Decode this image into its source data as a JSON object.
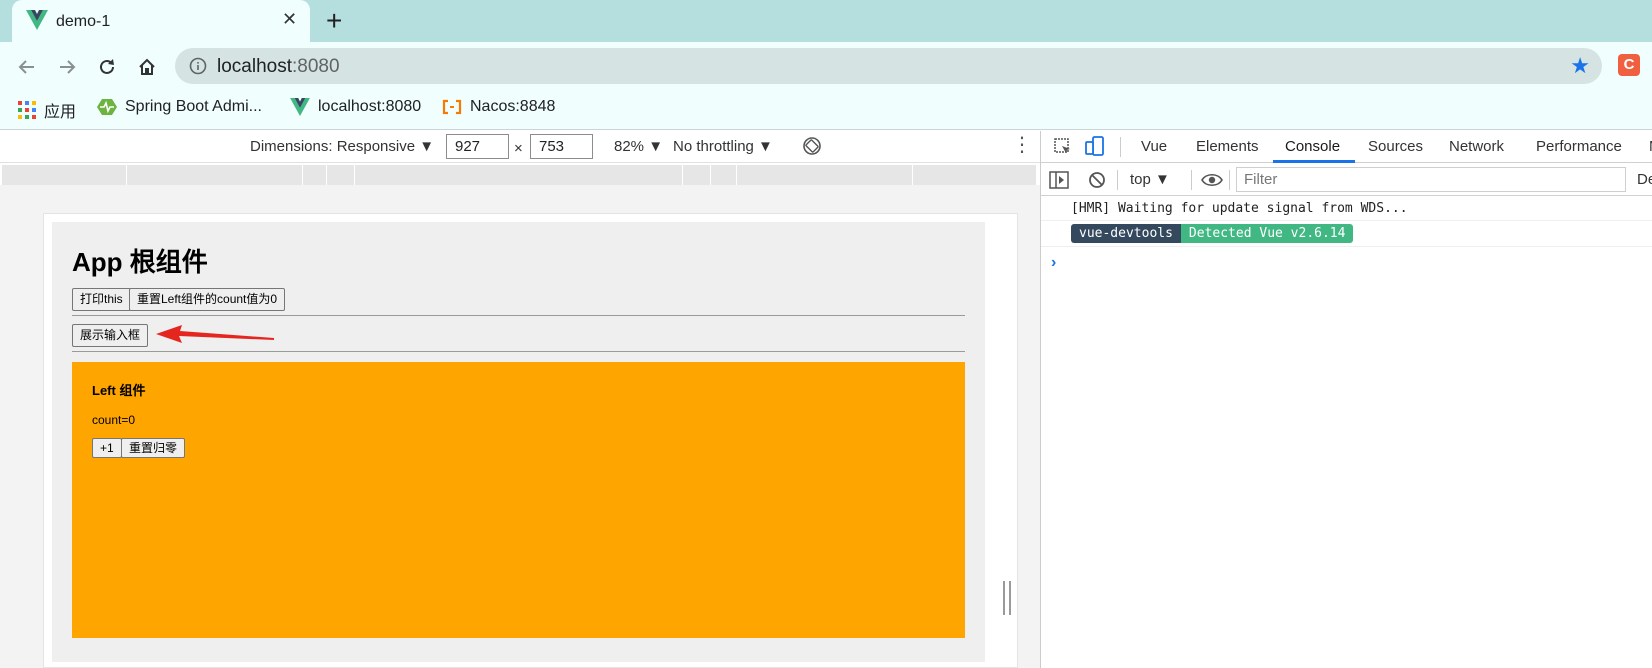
{
  "browser": {
    "tab": {
      "title": "demo-1",
      "close": "✕",
      "favicon": "vue-logo-icon"
    },
    "new_tab": "+",
    "url": {
      "host": "localhost",
      "port": ":8080"
    },
    "extension_letter": "C",
    "bookmarks": [
      {
        "label": "应用",
        "icon": "apps-grid-icon"
      },
      {
        "label": "Spring Boot Admi...",
        "icon": "spring-boot-admin-icon"
      },
      {
        "label": "localhost:8080",
        "icon": "vue-logo-icon"
      },
      {
        "label": "Nacos:8848",
        "icon": "nacos-icon"
      }
    ],
    "colors": {
      "tab_strip": "#b4dfde",
      "toolbar": "#f0fefe",
      "star": "#1a73e8"
    }
  },
  "device_toolbar": {
    "dimensions": "Dimensions: Responsive ▼",
    "width": "927",
    "times": "×",
    "height": "753",
    "zoom": "82% ▼",
    "throttling": "No throttling ▼"
  },
  "app": {
    "title": "App 根组件",
    "buttons": {
      "print_this": "打印this",
      "reset_left": "重置Left组件的count值为0",
      "show_input": "展示输入框"
    },
    "left": {
      "title": "Left 组件",
      "count": "count=0",
      "plus_one": "+1",
      "reset": "重置归零",
      "background": "#ffa500"
    }
  },
  "devtools": {
    "tabs": [
      "Vue",
      "Elements",
      "Console",
      "Sources",
      "Network",
      "Performance",
      "M"
    ],
    "active_tab": "Console",
    "context": "top ▼",
    "filter_placeholder": "Filter",
    "cut_label": "De",
    "console": {
      "line1": "[HMR] Waiting for update signal from WDS...",
      "badge_left": "vue-devtools",
      "badge_right": "Detected Vue v2.6.14",
      "badge_left_color": "#35495e",
      "badge_right_color": "#41b883",
      "prompt": "›"
    }
  }
}
